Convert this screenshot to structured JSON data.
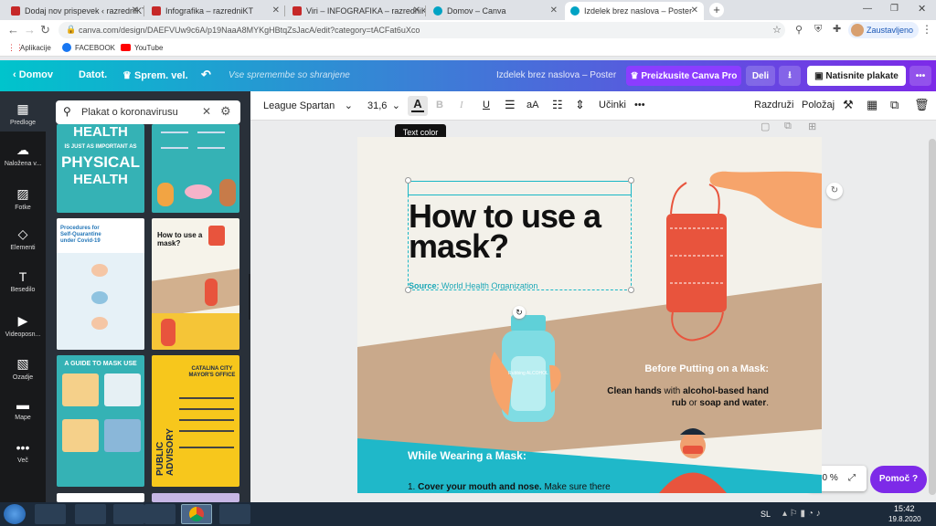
{
  "browser": {
    "tabs": [
      {
        "title": "Dodaj nov prispevek ‹ razredniKT"
      },
      {
        "title": "Infografika – razredniKT"
      },
      {
        "title": "Viri – INFOGRAFIKA – razredniKT"
      },
      {
        "title": "Domov – Canva"
      },
      {
        "title": "Izdelek brez naslova – Poster"
      }
    ],
    "url": "canva.com/design/DAEFVUw9c6A/p19NaaA8MYKgHBtqZsJacA/edit?category=tACFat6uXco",
    "profile_label": "Zaustavljeno",
    "bookmarks": [
      "Aplikacije",
      "FACEBOOK",
      "YouTube"
    ]
  },
  "canva_header": {
    "home": "Domov",
    "file": "Datot.",
    "resize": "Sprem. vel.",
    "save_status": "Vse spremembe so shranjene",
    "doc_title": "Izdelek brez naslova – Poster",
    "try_pro": "Preizkusite Canva Pro",
    "share": "Deli",
    "print": "Natisnite plakate"
  },
  "rail": [
    {
      "label": "Predloge",
      "icon": "template-icon"
    },
    {
      "label": "Naložena v...",
      "icon": "upload-icon"
    },
    {
      "label": "Fotke",
      "icon": "photo-icon"
    },
    {
      "label": "Elementi",
      "icon": "elements-icon"
    },
    {
      "label": "Besedilo",
      "icon": "text-icon"
    },
    {
      "label": "Videoposn...",
      "icon": "video-icon"
    },
    {
      "label": "Ozadje",
      "icon": "background-icon"
    },
    {
      "label": "Mape",
      "icon": "folder-icon"
    },
    {
      "label": "Več",
      "icon": "more-icon"
    }
  ],
  "search": {
    "value": "Plakat o koronavirusu"
  },
  "templates": {
    "t1_line1": "IS JUST AS IMPORTANT AS",
    "t1_big1": "HEALTH",
    "t1_big2": "PHYSICAL",
    "t1_big3": "HEALTH",
    "t3_title": "Procedures for Self-Quarantine under Covid-19",
    "t4_title": "How to use a mask?",
    "t5_title": "A GUIDE TO MASK USE",
    "t6_title": "CATALINA CITY MAYOR'S OFFICE",
    "t6_side": "PUBLIC ADVISORY"
  },
  "toolbar": {
    "font": "League Spartan",
    "size": "31,6",
    "text_color_letter": "A",
    "tooltip": "Text color",
    "bold": "B",
    "italic": "I",
    "underline": "U",
    "case": "aA",
    "effects": "Učinki",
    "more": "•••",
    "arrange": "Razdruži",
    "position": "Položaj"
  },
  "poster": {
    "title_line1": "How to use a",
    "title_line2": "mask?",
    "source_label": "Source:",
    "source_value": "World Health Organization",
    "bottle_label": "Rubbing ALCOHOL",
    "before_heading": "Before Putting on a Mask:",
    "before_b1": "Clean hands",
    "before_t1": " with ",
    "before_b2": "alcohol-based hand rub",
    "before_t2": " or ",
    "before_b3": "soap and water",
    "before_t3": ".",
    "while_heading": "While Wearing a Mask:",
    "while_num": "1.",
    "while_b1": "Cover your mouth and nose.",
    "while_t1": " Make sure there"
  },
  "zoom": "50 %",
  "help": "Pomoč ?",
  "taskbar": {
    "lang": "SL",
    "time": "15:42",
    "date": "19.8.2020"
  },
  "colors": {
    "teal": "#00bcd4",
    "purple": "#7d2ae8",
    "poster_tan": "#c9a98b",
    "poster_teal": "#1fb8c9",
    "mask_red": "#e8543d"
  }
}
